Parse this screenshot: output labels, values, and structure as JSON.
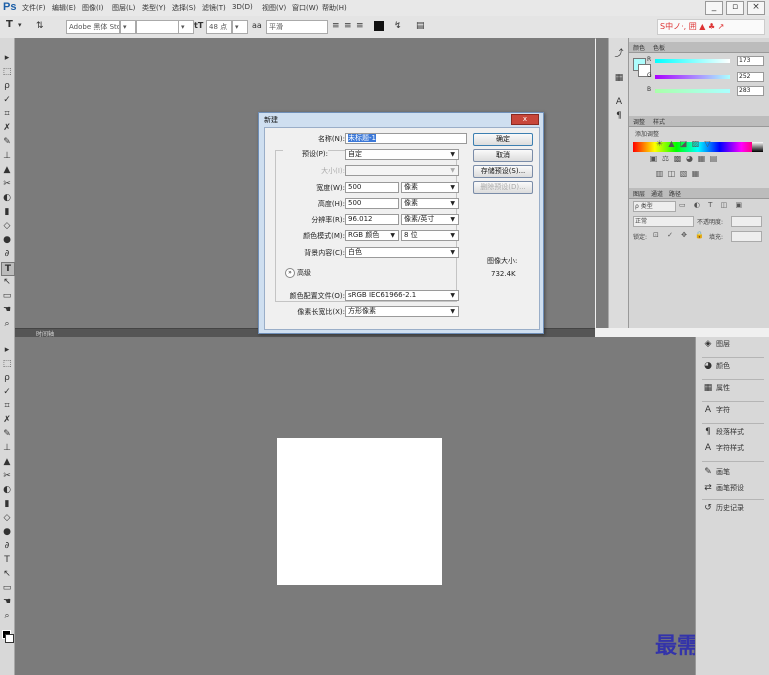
{
  "app": {
    "logo": "Ps"
  },
  "menubar": {
    "items": [
      "文件(F)",
      "编辑(E)",
      "图像(I)",
      "图层(L)",
      "类型(Y)",
      "选择(S)",
      "滤镜(T)",
      "3D(D)",
      "视图(V)",
      "窗口(W)",
      "帮助(H)"
    ],
    "window_controls": [
      "_",
      "▫",
      "×"
    ]
  },
  "options_bar": {
    "tool_glyph": "T",
    "font_family": "Adobe 黑体 Std",
    "font_size": "48 点",
    "anti_alias_prefix": "aa",
    "anti_alias": "平滑",
    "ime_text": "S中ノ·, 囲 ▲ ♣ ↗"
  },
  "toolbar": {
    "tools": [
      "▸",
      "⬚",
      "ρ",
      "✓",
      "⌗",
      "✗",
      "✎",
      "⊥",
      "▲",
      "✂",
      "◐",
      "▮",
      "◇",
      "●",
      "∂",
      "T",
      "↖",
      "▭",
      "☚",
      "⌕"
    ]
  },
  "toolbar2": {
    "tools": [
      "▸",
      "⬚",
      "ρ",
      "✓",
      "⌗",
      "✗",
      "✎",
      "⊥",
      "▲",
      "✂",
      "◐",
      "▮",
      "◇",
      "●",
      "∂",
      "T",
      "↖",
      "▭",
      "☚",
      "⌕"
    ]
  },
  "document": {
    "tab_label": "时间轴"
  },
  "watermark": {
    "text": "最需网"
  },
  "icon_strip": {
    "icons": [
      "⤴",
      "▦",
      "A",
      "¶"
    ]
  },
  "color_panel": {
    "tabs": [
      "颜色",
      "色板"
    ],
    "channels": [
      {
        "label": "R",
        "value": "173"
      },
      {
        "label": "G",
        "value": "252"
      },
      {
        "label": "B",
        "value": "283"
      }
    ],
    "colors": {
      "foreground": "#adfcfc",
      "background": "#ffffff"
    }
  },
  "adjustments_panel": {
    "tabs": [
      "调整",
      "样式"
    ],
    "subtitle": "添加调整",
    "icons": [
      "☀",
      "▲",
      "◪",
      "▨",
      "▽",
      "▣",
      "⚖",
      "▩",
      "◕",
      "▦",
      "▤",
      "▥",
      "◫",
      "▧",
      "▦"
    ]
  },
  "layers_panel": {
    "tabs": [
      "图层",
      "通道",
      "路径"
    ],
    "kind": "ρ 类型",
    "blend_mode": "正常",
    "opacity_label": "不透明度:",
    "lock_label": "锁定:",
    "fill_label": "填充:"
  },
  "right_panel2": {
    "items": [
      {
        "icon": "◈",
        "label": "图层"
      },
      {
        "icon": "◕",
        "label": "颜色"
      },
      {
        "icon": "▦",
        "label": "属性"
      },
      {
        "icon": "A",
        "label": "字符"
      },
      {
        "icon": "¶",
        "label": "段落样式"
      },
      {
        "icon": "A",
        "label": "字符样式"
      },
      {
        "icon": "✎",
        "label": "画笔"
      },
      {
        "icon": "⇄",
        "label": "画笔预设"
      },
      {
        "icon": "↺",
        "label": "历史记录"
      }
    ]
  },
  "new_dialog": {
    "title": "新建",
    "close": "x",
    "name_label": "名称(N):",
    "name_value": "未标题-1",
    "preset_label": "预设(P):",
    "preset_value": "自定",
    "size_label": "大小(I):",
    "width_label": "宽度(W):",
    "width_value": "500",
    "width_unit": "像素",
    "height_label": "高度(H):",
    "height_value": "500",
    "height_unit": "像素",
    "resolution_label": "分辨率(R):",
    "resolution_value": "96.012",
    "resolution_unit": "像素/英寸",
    "color_mode_label": "颜色模式(M):",
    "color_mode_value": "RGB 颜色",
    "bit_depth_value": "8 位",
    "background_label": "背景内容(C):",
    "background_value": "白色",
    "advanced_label": "高级",
    "profile_label": "颜色配置文件(O):",
    "profile_value": "sRGB IEC61966-2.1",
    "pixel_aspect_label": "像素长宽比(X):",
    "pixel_aspect_value": "方形像素",
    "ok_button": "确定",
    "cancel_button": "取消",
    "save_preset_button": "存储预设(S)...",
    "delete_preset_button": "删除预设(D)...",
    "image_size_label": "图像大小:",
    "image_size_value": "732.4K"
  }
}
